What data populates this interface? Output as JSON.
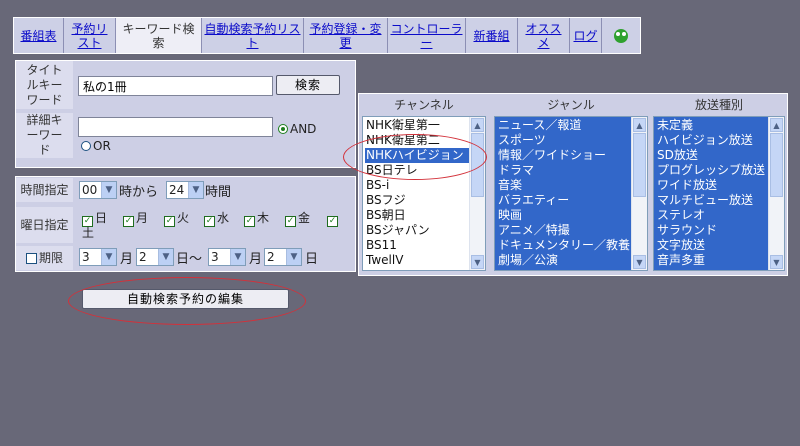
{
  "nav": {
    "items": [
      {
        "label": "番組表",
        "active": false
      },
      {
        "label": "予約リスト",
        "active": false
      },
      {
        "label": "キーワード検索",
        "active": true
      },
      {
        "label": "自動検索予約リスト",
        "active": false
      },
      {
        "label": "予約登録・変更",
        "active": false
      },
      {
        "label": "コントローラー",
        "active": false
      },
      {
        "label": "新番組",
        "active": false
      },
      {
        "label": "オススメ",
        "active": false
      },
      {
        "label": "ログ",
        "active": false
      }
    ],
    "icon": "frog-icon"
  },
  "search": {
    "title_label": "タイトルキーワード",
    "title_value": "私の1冊",
    "search_button": "検索",
    "detail_label": "詳細キーワード",
    "detail_value": "",
    "and_label": "AND",
    "or_label": "OR",
    "mode": "AND"
  },
  "time": {
    "label": "時間指定",
    "from_value": "00",
    "from_suffix": "時から",
    "to_value": "24",
    "to_suffix": "時間"
  },
  "weekday": {
    "label": "曜日指定",
    "days": [
      {
        "label": "日",
        "checked": true
      },
      {
        "label": "月",
        "checked": true
      },
      {
        "label": "火",
        "checked": true
      },
      {
        "label": "水",
        "checked": true
      },
      {
        "label": "木",
        "checked": true
      },
      {
        "label": "金",
        "checked": true
      },
      {
        "label": "土",
        "checked": true
      }
    ]
  },
  "period": {
    "label": "期限",
    "checked": false,
    "start_month": "3",
    "month_unit": "月",
    "start_day": "2",
    "day_unit_tilde": "日〜",
    "end_month": "3",
    "end_day": "2",
    "day_unit": "日"
  },
  "edit_button": "自動検索予約の編集",
  "lists": {
    "channel": {
      "header": "チャンネル",
      "options": [
        "NHK衛星第一",
        "NHK衛星第二",
        "NHKハイビジョン",
        "BS日テレ",
        "BS-i",
        "BSフジ",
        "BS朝日",
        "BSジャパン",
        "BS11",
        "TwellV"
      ],
      "selected": [
        "NHKハイビジョン"
      ]
    },
    "genre": {
      "header": "ジャンル",
      "options": [
        "ニュース／報道",
        "スポーツ",
        "情報／ワイドショー",
        "ドラマ",
        "音楽",
        "バラエティー",
        "映画",
        "アニメ／特撮",
        "ドキュメンタリー／教養",
        "劇場／公演"
      ],
      "all_selected": true
    },
    "broadcast": {
      "header": "放送種別",
      "options": [
        "未定義",
        "ハイビジョン放送",
        "SD放送",
        "プログレッシブ放送",
        "ワイド放送",
        "マルチビュー放送",
        "ステレオ",
        "サラウンド",
        "文字放送",
        "音声多重"
      ],
      "all_selected": true
    }
  },
  "colors": {
    "background": "#686878",
    "panel": "#CDCFE5",
    "nav_link": "#0B0BC9",
    "selection": "#3267C9",
    "highlight_ellipse": "#D3313A"
  }
}
